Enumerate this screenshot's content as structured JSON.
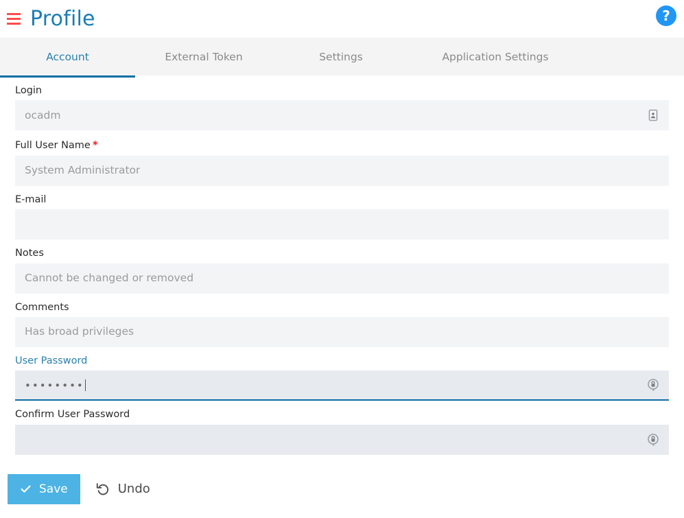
{
  "header": {
    "menu_icon": "hamburger-icon",
    "title": "Profile",
    "help_icon": "question-mark-icon",
    "help_label": "?",
    "menu_color": "#ff4b4b",
    "title_color": "#1b7cb5",
    "help_color": "#2196f3"
  },
  "tabs": [
    {
      "label": "Account",
      "active": true
    },
    {
      "label": "External Token",
      "active": false
    },
    {
      "label": "Settings",
      "active": false
    },
    {
      "label": "Application Settings",
      "active": false
    }
  ],
  "form": {
    "login": {
      "label": "Login",
      "value": "ocadm",
      "icon": "id-badge-icon",
      "disabled": true
    },
    "full_user_name": {
      "label": "Full User Name",
      "required_marker": "*",
      "value": "System Administrator",
      "disabled": true
    },
    "email": {
      "label": "E-mail",
      "value": "",
      "disabled": true
    },
    "notes": {
      "label": "Notes",
      "value": "Cannot be changed or removed",
      "disabled": true
    },
    "comments": {
      "label": "Comments",
      "value": "Has broad privileges",
      "disabled": true
    },
    "user_password": {
      "label": "User Password",
      "value": "••••••••",
      "icon": "password-key-icon",
      "focused": true
    },
    "confirm_user_password": {
      "label": "Confirm User Password",
      "value": "",
      "icon": "password-key-icon",
      "focused": false
    }
  },
  "actions": {
    "save_label": "Save",
    "save_icon": "check-icon",
    "save_color": "#4cb3e4",
    "undo_label": "Undo",
    "undo_icon": "undo-arrow-icon"
  }
}
